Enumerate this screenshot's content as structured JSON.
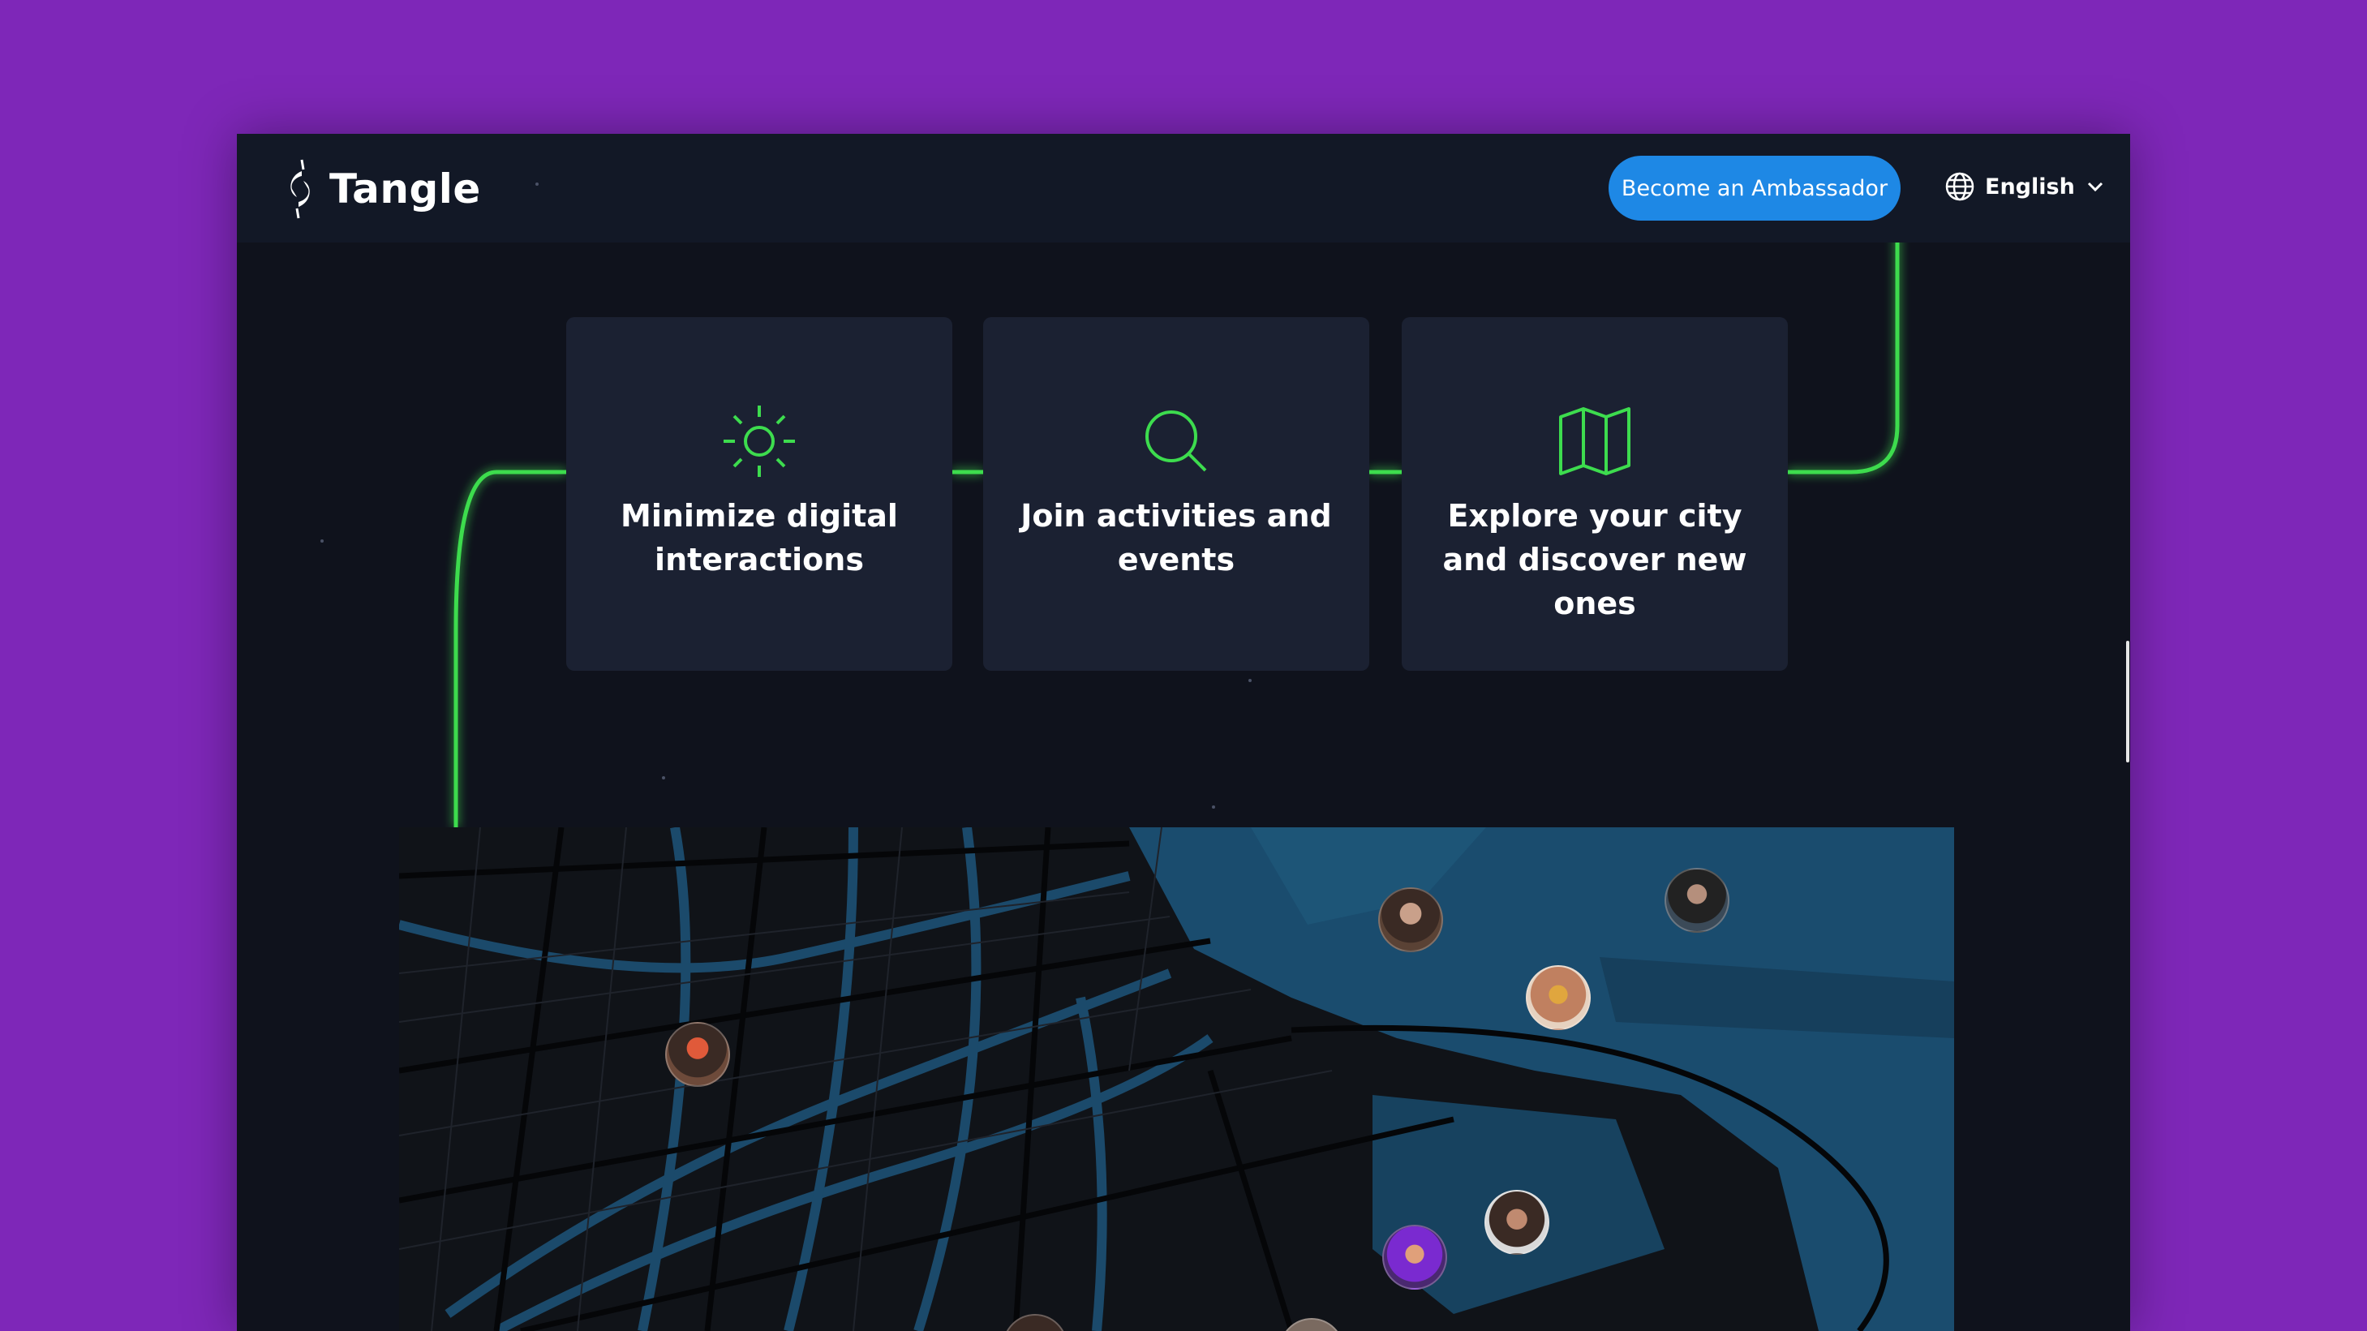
{
  "header": {
    "brand": "Tangle",
    "ambassador_button": "Become an Ambassador",
    "language": "English"
  },
  "features": [
    {
      "icon": "sun-icon",
      "title": "Minimize digital interactions"
    },
    {
      "icon": "search-icon",
      "title": "Join activities and events"
    },
    {
      "icon": "map-icon",
      "title": "Explore your city and discover new ones"
    }
  ],
  "colors": {
    "background": "#7e27b8",
    "accent_green": "#3ddc4e",
    "button_blue": "#1e88e5",
    "card": "#1b2132"
  }
}
